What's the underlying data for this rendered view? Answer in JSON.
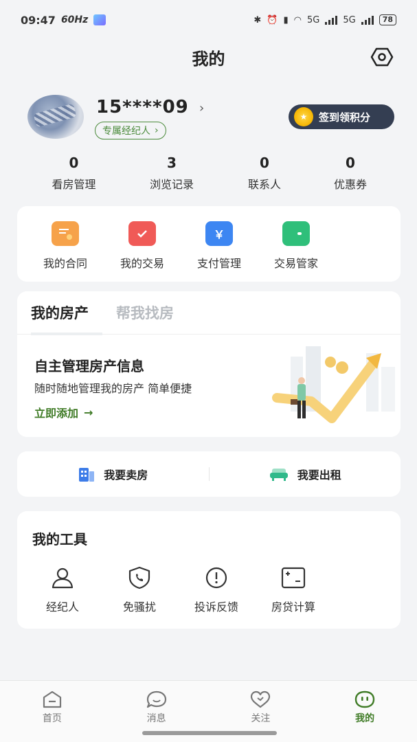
{
  "status": {
    "time": "09:47",
    "refresh": "60Hz",
    "net1": "5G",
    "net2": "5G",
    "battery": "78"
  },
  "header": {
    "title": "我的"
  },
  "profile": {
    "phone": "15****09",
    "arrow": "›",
    "agent_tag": "专属经纪人",
    "agent_arrow": "›",
    "signin": "签到领积分"
  },
  "stats": [
    {
      "num": "0",
      "label": "看房管理"
    },
    {
      "num": "3",
      "label": "浏览记录"
    },
    {
      "num": "0",
      "label": "联系人"
    },
    {
      "num": "0",
      "label": "优惠券"
    }
  ],
  "quick": [
    {
      "label": "我的合同",
      "color": "#f6a24a"
    },
    {
      "label": "我的交易",
      "color": "#f05a57"
    },
    {
      "label": "支付管理",
      "color": "#3d86f2",
      "glyph": "￥"
    },
    {
      "label": "交易管家",
      "color": "#2fbf7a"
    }
  ],
  "property": {
    "tab_active": "我的房产",
    "tab_inactive": "帮我找房",
    "title": "自主管理房产信息",
    "subtitle": "随时随地管理我的房产 简单便捷",
    "link": "立即添加",
    "link_arrow": "→"
  },
  "sellrent": {
    "sell": "我要卖房",
    "rent": "我要出租"
  },
  "tools": {
    "title": "我的工具",
    "items": [
      {
        "label": "经纪人",
        "icon": "person-icon"
      },
      {
        "label": "免骚扰",
        "icon": "shield-phone-icon"
      },
      {
        "label": "投诉反馈",
        "icon": "alert-icon"
      },
      {
        "label": "房贷计算",
        "icon": "calculator-icon"
      }
    ]
  },
  "tabbar": [
    {
      "label": "首页"
    },
    {
      "label": "消息"
    },
    {
      "label": "关注"
    },
    {
      "label": "我的"
    }
  ],
  "colors": {
    "accent": "#3f7b26",
    "signin_bg": "#343e52"
  }
}
